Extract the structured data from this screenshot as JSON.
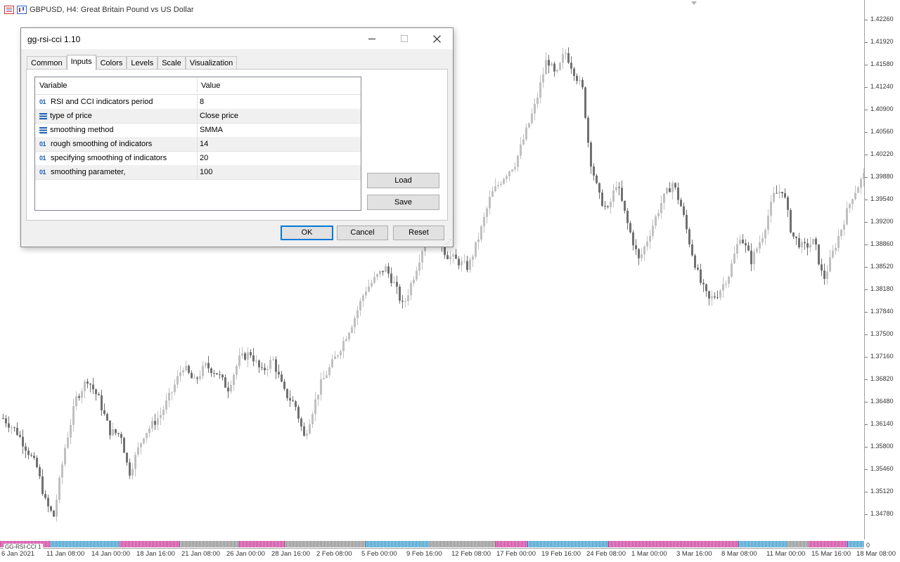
{
  "header": {
    "title": "GBPUSD, H4:  Great Britain Pound vs US Dollar"
  },
  "price_axis": {
    "labels": [
      "1.42260",
      "1.41920",
      "1.41580",
      "1.41240",
      "1.40900",
      "1.40560",
      "1.40220",
      "1.39880",
      "1.39540",
      "1.39200",
      "1.38860",
      "1.38520",
      "1.38180",
      "1.37840",
      "1.37500",
      "1.37160",
      "1.36820",
      "1.36480",
      "1.36140",
      "1.35800",
      "1.35460",
      "1.35120",
      "1.34780"
    ]
  },
  "time_axis": {
    "labels": [
      "6 Jan 2021",
      "11 Jan 08:00",
      "14 Jan 00:00",
      "18 Jan 16:00",
      "21 Jan 08:00",
      "26 Jan 00:00",
      "28 Jan 16:00",
      "2 Feb 08:00",
      "5 Feb 00:00",
      "9 Feb 16:00",
      "12 Feb 08:00",
      "17 Feb 00:00",
      "19 Feb 16:00",
      "24 Feb 08:00",
      "1 Mar 00:00",
      "3 Mar 16:00",
      "8 Mar 08:00",
      "11 Mar 00:00",
      "15 Mar 16:00",
      "18 Mar 08:00"
    ]
  },
  "indicator_strip": {
    "label": "GG-RSI-CCI 1",
    "end_value": "0",
    "colors": {
      "buy": "#3399cc",
      "sell": "#cc3399",
      "neutral": "#8c8c8c"
    }
  },
  "dialog": {
    "title": "gg-rsi-cci 1.10",
    "tabs": [
      {
        "label": "Common",
        "active": false
      },
      {
        "label": "Inputs",
        "active": true
      },
      {
        "label": "Colors",
        "active": false
      },
      {
        "label": "Levels",
        "active": false
      },
      {
        "label": "Scale",
        "active": false
      },
      {
        "label": "Visualization",
        "active": false
      }
    ],
    "columns": {
      "variable": "Variable",
      "value": "Value"
    },
    "rows": [
      {
        "type_label": "01",
        "icon": "integer-icon",
        "name": "RSI and CCI indicators period",
        "value": "8"
      },
      {
        "type_label": "",
        "icon": "enum-list-icon",
        "name": "type of price",
        "value": "Close price"
      },
      {
        "type_label": "",
        "icon": "enum-list-icon",
        "name": "smoothing method",
        "value": "SMMA"
      },
      {
        "type_label": "01",
        "icon": "integer-icon",
        "name": "rough smoothing of indicators",
        "value": "14"
      },
      {
        "type_label": "01",
        "icon": "integer-icon",
        "name": "specifying smoothing of indicators",
        "value": "20"
      },
      {
        "type_label": "01",
        "icon": "integer-icon",
        "name": "smoothing parameter,",
        "value": "100"
      }
    ],
    "buttons": {
      "load": "Load",
      "save": "Save",
      "ok": "OK",
      "cancel": "Cancel",
      "reset": "Reset"
    }
  },
  "chart_data": {
    "type": "candlestick",
    "symbol": "GBPUSD",
    "timeframe": "H4",
    "ylim": [
      1.3435,
      1.4255
    ],
    "bull_color": "#c0c0c0",
    "bear_color": "#707070",
    "close_path": [
      [
        0,
        1.362
      ],
      [
        12,
        1.36
      ],
      [
        22,
        1.357
      ],
      [
        30,
        1.3545
      ],
      [
        38,
        1.349
      ],
      [
        45,
        1.347
      ],
      [
        55,
        1.3575
      ],
      [
        65,
        1.365
      ],
      [
        75,
        1.368
      ],
      [
        85,
        1.365
      ],
      [
        95,
        1.36
      ],
      [
        105,
        1.3595
      ],
      [
        112,
        1.3535
      ],
      [
        125,
        1.3595
      ],
      [
        140,
        1.3625
      ],
      [
        150,
        1.366
      ],
      [
        160,
        1.37
      ],
      [
        170,
        1.3675
      ],
      [
        180,
        1.37
      ],
      [
        190,
        1.369
      ],
      [
        200,
        1.3665
      ],
      [
        210,
        1.371
      ],
      [
        220,
        1.372
      ],
      [
        230,
        1.369
      ],
      [
        240,
        1.371
      ],
      [
        250,
        1.366
      ],
      [
        260,
        1.364
      ],
      [
        268,
        1.359
      ],
      [
        282,
        1.367
      ],
      [
        298,
        1.372
      ],
      [
        312,
        1.377
      ],
      [
        322,
        1.3815
      ],
      [
        332,
        1.3835
      ],
      [
        340,
        1.385
      ],
      [
        348,
        1.3825
      ],
      [
        356,
        1.379
      ],
      [
        366,
        1.384
      ],
      [
        376,
        1.3895
      ],
      [
        386,
        1.3905
      ],
      [
        394,
        1.387
      ],
      [
        404,
        1.386
      ],
      [
        414,
        1.385
      ],
      [
        424,
        1.39
      ],
      [
        434,
        1.396
      ],
      [
        446,
        1.399
      ],
      [
        456,
        1.401
      ],
      [
        466,
        1.406
      ],
      [
        474,
        1.41
      ],
      [
        484,
        1.417
      ],
      [
        492,
        1.414
      ],
      [
        500,
        1.418
      ],
      [
        508,
        1.415
      ],
      [
        516,
        1.412
      ],
      [
        522,
        1.402
      ],
      [
        530,
        1.396
      ],
      [
        538,
        1.3935
      ],
      [
        546,
        1.398
      ],
      [
        556,
        1.3915
      ],
      [
        566,
        1.386
      ],
      [
        576,
        1.3905
      ],
      [
        586,
        1.395
      ],
      [
        596,
        1.398
      ],
      [
        604,
        1.394
      ],
      [
        612,
        1.388
      ],
      [
        620,
        1.383
      ],
      [
        628,
        1.38
      ],
      [
        636,
        1.381
      ],
      [
        646,
        1.384
      ],
      [
        656,
        1.39
      ],
      [
        666,
        1.386
      ],
      [
        676,
        1.39
      ],
      [
        686,
        1.396
      ],
      [
        694,
        1.397
      ],
      [
        702,
        1.39
      ],
      [
        712,
        1.388
      ],
      [
        722,
        1.389
      ],
      [
        730,
        1.383
      ],
      [
        738,
        1.387
      ],
      [
        748,
        1.392
      ],
      [
        756,
        1.396
      ],
      [
        766,
        1.399
      ]
    ]
  }
}
